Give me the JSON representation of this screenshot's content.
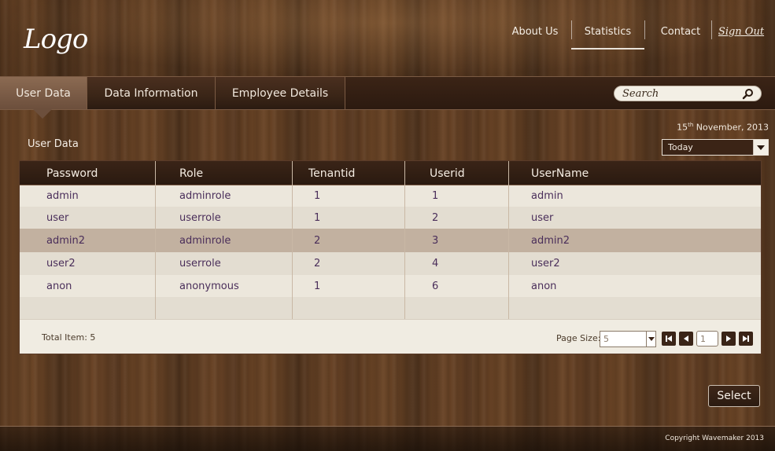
{
  "header": {
    "logo": "Logo",
    "nav": [
      {
        "label": "About Us"
      },
      {
        "label": "Statistics"
      },
      {
        "label": "Contact"
      }
    ],
    "sign_out": "Sign Out"
  },
  "tabs": [
    {
      "label": "User Data",
      "active": true
    },
    {
      "label": "Data Information",
      "active": false
    },
    {
      "label": "Employee Details",
      "active": false
    }
  ],
  "search": {
    "placeholder": "Search"
  },
  "date": {
    "day": "15",
    "suffix": "th",
    "rest": "November, 2013"
  },
  "section_title": "User Data",
  "filter": {
    "selected": "Today"
  },
  "table": {
    "columns": [
      "Password",
      "Role",
      "Tenantid",
      "Userid",
      "UserName"
    ],
    "rows": [
      [
        "admin",
        "adminrole",
        "1",
        "1",
        "admin"
      ],
      [
        "user",
        "userrole",
        "1",
        "2",
        "user"
      ],
      [
        "admin2",
        "adminrole",
        "2",
        "3",
        "admin2"
      ],
      [
        "user2",
        "userrole",
        "2",
        "4",
        "user2"
      ],
      [
        "anon",
        "anonymous",
        "1",
        "6",
        "anon"
      ]
    ],
    "selected_row": 2,
    "total_label": "Total Item: 5",
    "page_size_label": "Page Size:",
    "page_size": "5",
    "page": "1"
  },
  "actions": {
    "select": "Select"
  },
  "footer": {
    "copyright": "Copyright Wavemaker 2013"
  },
  "colors": {
    "accent_header": "#2c1a10",
    "row_even": "#ece7dc",
    "row_odd": "#e3ddd1",
    "row_selected": "#c2b1a0",
    "cell_text": "#4a2e5a"
  }
}
